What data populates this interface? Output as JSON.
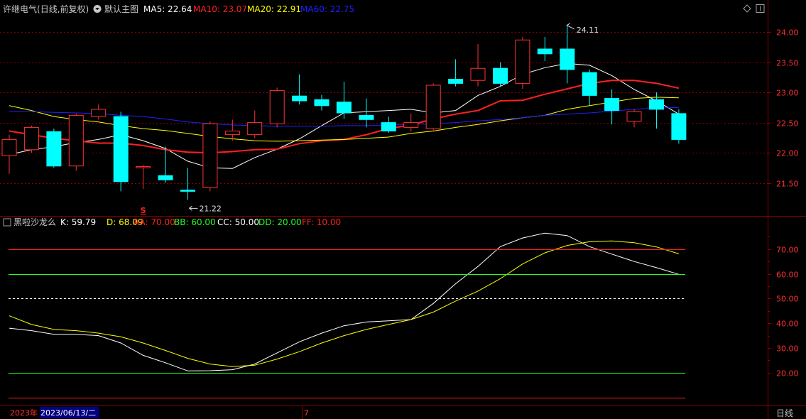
{
  "header": {
    "stock": "许继电气",
    "mode": "(日线,前复权)",
    "template": "默认主图",
    "ma": [
      {
        "label": "MA5: 22.64",
        "color": "#ffffff"
      },
      {
        "label": "MA10: 23.07",
        "color": "#ff2020"
      },
      {
        "label": "MA20: 22.91",
        "color": "#ffff00"
      },
      {
        "label": "MA60: 22.75",
        "color": "#2020ff"
      }
    ]
  },
  "sub_header": {
    "name": "黑啦沙龙么",
    "items": [
      {
        "label": "K: 59.79",
        "color": "#ffffff"
      },
      {
        "label": "D: 68.09",
        "color": "#ffff00"
      },
      {
        "label": "AA: 70.00",
        "color": "#ff2020"
      },
      {
        "label": "BB: 60.00",
        "color": "#20ff20"
      },
      {
        "label": "CC: 50.00",
        "color": "#ffffff"
      },
      {
        "label": "DD: 20.00",
        "color": "#20ff20"
      },
      {
        "label": "FF: 10.00",
        "color": "#ff2020"
      }
    ]
  },
  "bottom_bar": {
    "year": "2023年",
    "date": "2023/06/13/二",
    "month_mark": "7",
    "period_button": "日线"
  },
  "annotations": {
    "high_label": "24.11",
    "low_label": "21.22",
    "signal": "S"
  },
  "colors": {
    "up": "#ff3232",
    "down": "#00ffff",
    "grid": "#8b0000",
    "axis_text": "#ff3232"
  },
  "chart_data": [
    {
      "type": "candlestick",
      "y_ticks": [
        "21.50",
        "22.00",
        "22.50",
        "23.00",
        "23.50",
        "24.00"
      ],
      "ylim": [
        21.0,
        24.25
      ],
      "candles": [
        {
          "o": 21.95,
          "h": 22.3,
          "c": 22.22,
          "l": 21.65
        },
        {
          "o": 22.05,
          "h": 22.45,
          "c": 22.42,
          "l": 22.0
        },
        {
          "o": 22.35,
          "h": 22.4,
          "c": 21.78,
          "l": 21.75
        },
        {
          "o": 21.78,
          "h": 22.65,
          "c": 22.62,
          "l": 21.7
        },
        {
          "o": 22.6,
          "h": 22.8,
          "c": 22.72,
          "l": 22.55
        },
        {
          "o": 22.6,
          "h": 22.68,
          "c": 21.52,
          "l": 21.36
        },
        {
          "o": 21.75,
          "h": 21.8,
          "c": 21.77,
          "l": 21.4
        },
        {
          "o": 21.62,
          "h": 22.1,
          "c": 21.55,
          "l": 21.5
        },
        {
          "o": 21.38,
          "h": 21.75,
          "c": 21.36,
          "l": 21.22
        },
        {
          "o": 21.42,
          "h": 22.52,
          "c": 22.48,
          "l": 21.36
        },
        {
          "o": 22.3,
          "h": 22.55,
          "c": 22.36,
          "l": 22.2
        },
        {
          "o": 22.3,
          "h": 22.7,
          "c": 22.5,
          "l": 22.24
        },
        {
          "o": 22.48,
          "h": 23.08,
          "c": 23.03,
          "l": 22.42
        },
        {
          "o": 22.94,
          "h": 23.3,
          "c": 22.86,
          "l": 22.8
        },
        {
          "o": 22.88,
          "h": 22.96,
          "c": 22.78,
          "l": 22.7
        },
        {
          "o": 22.84,
          "h": 23.18,
          "c": 22.66,
          "l": 22.56
        },
        {
          "o": 22.62,
          "h": 22.9,
          "c": 22.55,
          "l": 22.42
        },
        {
          "o": 22.5,
          "h": 22.6,
          "c": 22.36,
          "l": 22.33
        },
        {
          "o": 22.42,
          "h": 22.65,
          "c": 22.5,
          "l": 22.35
        },
        {
          "o": 22.4,
          "h": 23.15,
          "c": 23.12,
          "l": 22.37
        },
        {
          "o": 23.22,
          "h": 23.55,
          "c": 23.15,
          "l": 23.1
        },
        {
          "o": 23.2,
          "h": 23.8,
          "c": 23.4,
          "l": 23.1
        },
        {
          "o": 23.4,
          "h": 23.5,
          "c": 23.15,
          "l": 23.1
        },
        {
          "o": 23.15,
          "h": 23.92,
          "c": 23.87,
          "l": 23.06
        },
        {
          "o": 23.72,
          "h": 23.92,
          "c": 23.64,
          "l": 23.52
        },
        {
          "o": 23.72,
          "h": 24.11,
          "c": 23.38,
          "l": 23.15
        },
        {
          "o": 23.33,
          "h": 23.38,
          "c": 22.95,
          "l": 22.78
        },
        {
          "o": 22.9,
          "h": 23.05,
          "c": 22.7,
          "l": 22.47
        },
        {
          "o": 22.52,
          "h": 22.72,
          "c": 22.68,
          "l": 22.42
        },
        {
          "o": 22.88,
          "h": 23.0,
          "c": 22.72,
          "l": 22.4
        },
        {
          "o": 22.65,
          "h": 22.72,
          "c": 22.22,
          "l": 22.15
        }
      ],
      "ma_series": [
        {
          "name": "MA5",
          "color": "#ffffff",
          "width": 1,
          "values": [
            21.97,
            22.05,
            22.1,
            22.17,
            22.22,
            22.3,
            22.2,
            22.07,
            21.86,
            21.75,
            21.74,
            21.92,
            22.06,
            22.23,
            22.45,
            22.66,
            22.68,
            22.7,
            22.72,
            22.66,
            22.7,
            22.95,
            23.1,
            23.3,
            23.41,
            23.48,
            23.45,
            23.28,
            23.05,
            22.86,
            22.64
          ]
        },
        {
          "name": "MA10",
          "color": "#ff2020",
          "width": 2,
          "values": [
            22.36,
            22.3,
            22.24,
            22.2,
            22.16,
            22.16,
            22.12,
            22.05,
            22.01,
            22.0,
            22.02,
            22.05,
            22.06,
            22.15,
            22.2,
            22.22,
            22.3,
            22.4,
            22.46,
            22.56,
            22.64,
            22.7,
            22.86,
            22.87,
            22.97,
            23.06,
            23.15,
            23.2,
            23.2,
            23.15,
            23.07
          ]
        },
        {
          "name": "MA20",
          "color": "#ffff00",
          "width": 1,
          "values": [
            22.78,
            22.7,
            22.6,
            22.55,
            22.51,
            22.45,
            22.4,
            22.37,
            22.32,
            22.27,
            22.23,
            22.2,
            22.19,
            22.2,
            22.21,
            22.22,
            22.24,
            22.26,
            22.32,
            22.36,
            22.42,
            22.47,
            22.53,
            22.58,
            22.62,
            22.72,
            22.78,
            22.84,
            22.9,
            22.92,
            22.91
          ]
        },
        {
          "name": "MA60",
          "color": "#2020ff",
          "width": 1,
          "values": [
            22.68,
            22.68,
            22.67,
            22.66,
            22.65,
            22.62,
            22.6,
            22.56,
            22.51,
            22.48,
            22.46,
            22.45,
            22.44,
            22.44,
            22.44,
            22.45,
            22.45,
            22.46,
            22.47,
            22.48,
            22.5,
            22.53,
            22.55,
            22.58,
            22.62,
            22.64,
            22.66,
            22.69,
            22.72,
            22.74,
            22.75
          ]
        }
      ]
    },
    {
      "type": "line",
      "y_ticks": [
        "20.00",
        "30.00",
        "40.00",
        "50.00",
        "60.00",
        "70.00"
      ],
      "ylim": [
        7.0,
        80.0
      ],
      "x": [
        1,
        31
      ],
      "series": [
        {
          "name": "K",
          "color": "#ffffff",
          "values": [
            38.0,
            37.0,
            35.5,
            35.5,
            35.0,
            32.0,
            27.0,
            24.0,
            20.7,
            20.8,
            21.2,
            23.5,
            28.0,
            32.5,
            36.0,
            39.0,
            40.5,
            41.0,
            41.5,
            48.0,
            56.0,
            63.0,
            71.0,
            74.5,
            76.5,
            75.5,
            71.0,
            68.0,
            65.0,
            62.5,
            59.79
          ]
        },
        {
          "name": "D",
          "color": "#ffff00",
          "values": [
            43.0,
            39.5,
            37.5,
            37.0,
            36.0,
            34.5,
            32.0,
            29.0,
            25.8,
            23.5,
            22.5,
            23.0,
            25.5,
            28.5,
            32.0,
            35.0,
            37.5,
            39.5,
            41.5,
            44.5,
            49.0,
            53.0,
            58.0,
            64.0,
            68.5,
            71.5,
            73.0,
            73.3,
            72.6,
            70.9,
            68.09
          ]
        },
        {
          "name": "AA",
          "color": "#ff2020",
          "values": [
            70.0,
            70.0,
            70.0,
            70.0,
            70.0,
            70.0,
            70.0,
            70.0,
            70.0,
            70.0,
            70.0,
            70.0,
            70.0,
            70.0,
            70.0,
            70.0,
            70.0,
            70.0,
            70.0,
            70.0,
            70.0,
            70.0,
            70.0,
            70.0,
            70.0,
            70.0,
            70.0,
            70.0,
            70.0,
            70.0,
            70.0
          ]
        },
        {
          "name": "BB",
          "color": "#20ff20",
          "values": [
            60.0,
            60.0,
            60.0,
            60.0,
            60.0,
            60.0,
            60.0,
            60.0,
            60.0,
            60.0,
            60.0,
            60.0,
            60.0,
            60.0,
            60.0,
            60.0,
            60.0,
            60.0,
            60.0,
            60.0,
            60.0,
            60.0,
            60.0,
            60.0,
            60.0,
            60.0,
            60.0,
            60.0,
            60.0,
            60.0,
            60.0
          ]
        },
        {
          "name": "CC",
          "color": "#ffffff",
          "dashed": true,
          "values": [
            50.0,
            50.0,
            50.0,
            50.0,
            50.0,
            50.0,
            50.0,
            50.0,
            50.0,
            50.0,
            50.0,
            50.0,
            50.0,
            50.0,
            50.0,
            50.0,
            50.0,
            50.0,
            50.0,
            50.0,
            50.0,
            50.0,
            50.0,
            50.0,
            50.0,
            50.0,
            50.0,
            50.0,
            50.0,
            50.0,
            50.0
          ]
        },
        {
          "name": "DD",
          "color": "#20ff20",
          "values": [
            20.0,
            20.0,
            20.0,
            20.0,
            20.0,
            20.0,
            20.0,
            20.0,
            20.0,
            20.0,
            20.0,
            20.0,
            20.0,
            20.0,
            20.0,
            20.0,
            20.0,
            20.0,
            20.0,
            20.0,
            20.0,
            20.0,
            20.0,
            20.0,
            20.0,
            20.0,
            20.0,
            20.0,
            20.0,
            20.0,
            20.0
          ]
        },
        {
          "name": "FF",
          "color": "#ff2020",
          "values": [
            10.0,
            10.0,
            10.0,
            10.0,
            10.0,
            10.0,
            10.0,
            10.0,
            10.0,
            10.0,
            10.0,
            10.0,
            10.0,
            10.0,
            10.0,
            10.0,
            10.0,
            10.0,
            10.0,
            10.0,
            10.0,
            10.0,
            10.0,
            10.0,
            10.0,
            10.0,
            10.0,
            10.0,
            10.0,
            10.0,
            10.0
          ]
        }
      ]
    }
  ]
}
